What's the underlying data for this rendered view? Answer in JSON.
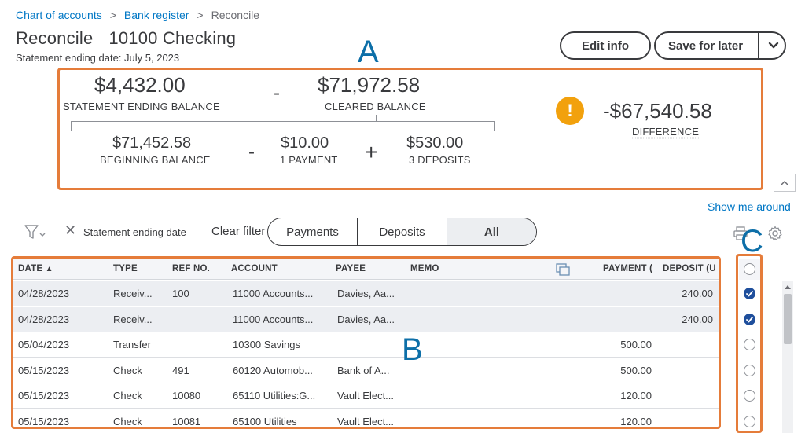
{
  "breadcrumb": {
    "items": [
      "Chart of accounts",
      "Bank register"
    ],
    "separator": ">",
    "current": "Reconcile"
  },
  "header": {
    "title": "Reconcile",
    "account": "10100 Checking",
    "statement_date": "Statement ending date: July 5, 2023",
    "edit_info_label": "Edit info",
    "save_for_later_label": "Save for later"
  },
  "annotations": {
    "a": "A",
    "b": "B",
    "c": "C"
  },
  "summary": {
    "statement_ending_balance": {
      "value": "$4,432.00",
      "label": "STATEMENT ENDING BALANCE"
    },
    "minus_op": "-",
    "cleared_balance": {
      "value": "$71,972.58",
      "label": "CLEARED BALANCE"
    },
    "beginning_balance": {
      "value": "$71,452.58",
      "label": "BEGINNING BALANCE"
    },
    "payments": {
      "value": "$10.00",
      "label": "1 PAYMENT"
    },
    "plus_op": "+",
    "deposits": {
      "value": "$530.00",
      "label": "3 DEPOSITS"
    },
    "difference": {
      "value": "-$67,540.58",
      "label": "DIFFERENCE"
    },
    "warning_glyph": "!"
  },
  "show_me_around": "Show me around",
  "filters": {
    "chip_close": "✕",
    "chip_label": "Statement ending date",
    "clear_label": "Clear filter",
    "tabs": [
      {
        "label": "Payments",
        "active": false
      },
      {
        "label": "Deposits",
        "active": false
      },
      {
        "label": "All",
        "active": true
      }
    ]
  },
  "table": {
    "columns": {
      "date": "DATE",
      "sort_arrow": "▲",
      "type": "TYPE",
      "ref": "REF NO.",
      "account": "ACCOUNT",
      "payee": "PAYEE",
      "memo": "MEMO",
      "payment": "PAYMENT (",
      "deposit": "DEPOSIT (U"
    },
    "rows": [
      {
        "date": "04/28/2023",
        "type": "Receiv...",
        "ref": "100",
        "account": "11000 Accounts...",
        "payee": "Davies, Aa...",
        "memo": "",
        "payment": "",
        "deposit": "240.00",
        "cleared": true
      },
      {
        "date": "04/28/2023",
        "type": "Receiv...",
        "ref": "",
        "account": "11000 Accounts...",
        "payee": "Davies, Aa...",
        "memo": "",
        "payment": "",
        "deposit": "240.00",
        "cleared": true
      },
      {
        "date": "05/04/2023",
        "type": "Transfer",
        "ref": "",
        "account": "10300 Savings",
        "payee": "",
        "memo": "",
        "payment": "500.00",
        "deposit": "",
        "cleared": false
      },
      {
        "date": "05/15/2023",
        "type": "Check",
        "ref": "491",
        "account": "60120 Automob...",
        "payee": "Bank of A...",
        "memo": "",
        "payment": "500.00",
        "deposit": "",
        "cleared": false
      },
      {
        "date": "05/15/2023",
        "type": "Check",
        "ref": "10080",
        "account": "65110 Utilities:G...",
        "payee": "Vault Elect...",
        "memo": "",
        "payment": "120.00",
        "deposit": "",
        "cleared": false
      },
      {
        "date": "05/15/2023",
        "type": "Check",
        "ref": "10081",
        "account": "65100 Utilities",
        "payee": "Vault Elect...",
        "memo": "",
        "payment": "120.00",
        "deposit": "",
        "cleared": false
      }
    ]
  },
  "colors": {
    "link": "#0077c5",
    "highlight_box": "#e57c3a",
    "annotation": "#0d6fa8",
    "warning": "#f2a10d",
    "checked": "#1f4f9c"
  },
  "icons": [
    "filter-icon",
    "chevron-down-icon",
    "close-icon",
    "warning-icon",
    "expand-columns-icon",
    "print-icon",
    "gear-icon",
    "checkmark-icon",
    "collapse-chevron-icon"
  ]
}
